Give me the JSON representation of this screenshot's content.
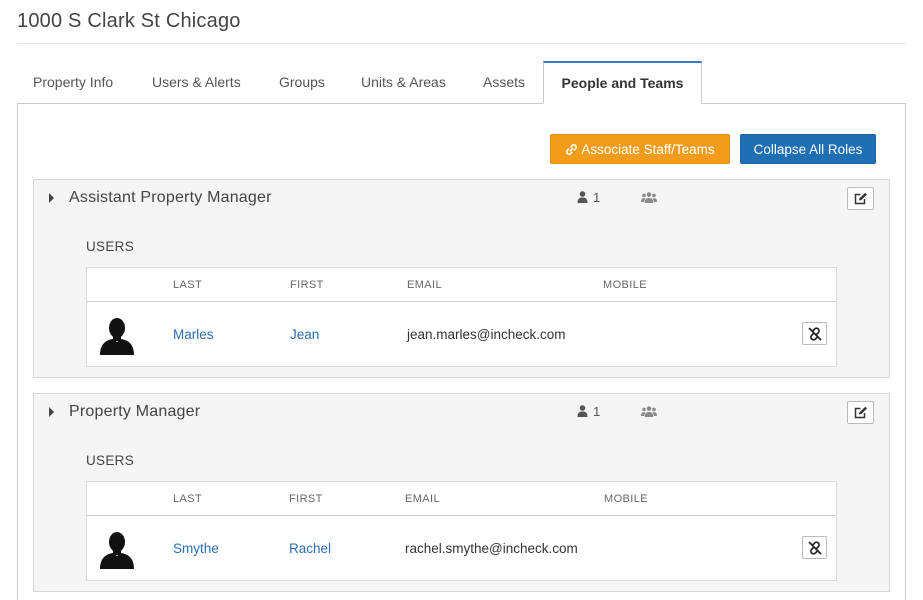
{
  "page": {
    "title": "1000 S Clark St Chicago"
  },
  "tabs": [
    {
      "label": "Property Info"
    },
    {
      "label": "Users & Alerts"
    },
    {
      "label": "Groups"
    },
    {
      "label": "Units & Areas"
    },
    {
      "label": "Assets"
    },
    {
      "label": "People and Teams",
      "active": true
    }
  ],
  "toolbar": {
    "associate_label": "Associate Staff/Teams",
    "collapse_label": "Collapse All Roles",
    "associate_color": "#f39c1b",
    "collapse_color": "#1f6fb5"
  },
  "columns": {
    "last": "LAST",
    "first": "FIRST",
    "email": "EMAIL",
    "mobile": "MOBILE"
  },
  "roles": [
    {
      "title": "Assistant Property Manager",
      "user_count": "1",
      "users_label": "USERS",
      "users": [
        {
          "last": "Marles",
          "first": "Jean",
          "email": "jean.marles@incheck.com",
          "mobile": ""
        }
      ]
    },
    {
      "title": "Property Manager",
      "user_count": "1",
      "users_label": "USERS",
      "users": [
        {
          "last": "Smythe",
          "first": "Rachel",
          "email": "rachel.smythe@incheck.com",
          "mobile": ""
        }
      ]
    }
  ],
  "icons": {
    "link": "link-icon",
    "user": "user-icon",
    "team": "users-icon",
    "edit": "edit-icon",
    "unlink": "unlink-icon",
    "avatar": "avatar-silhouette"
  }
}
